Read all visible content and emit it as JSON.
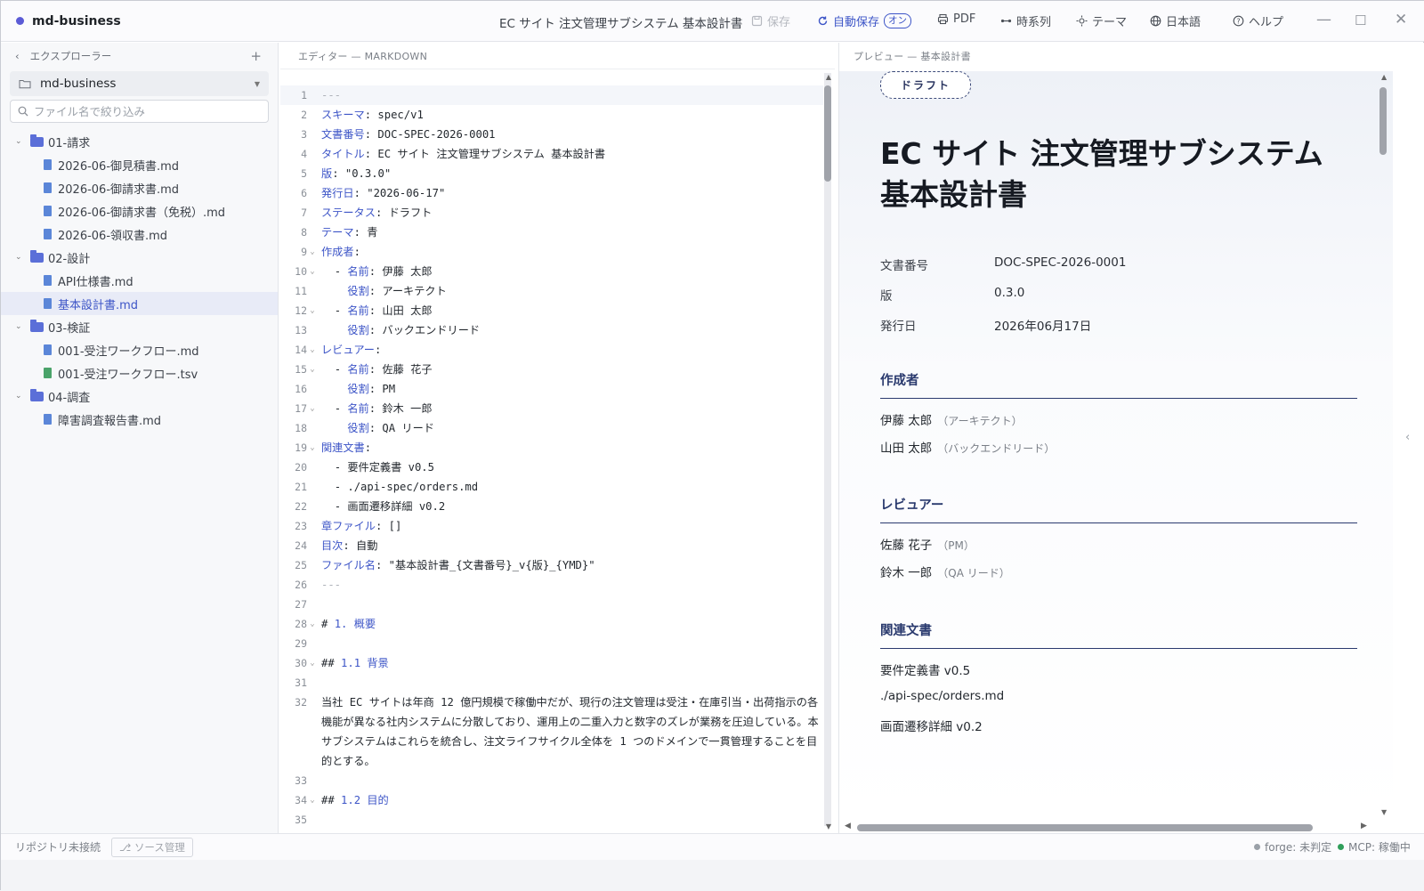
{
  "app": {
    "name": "md-business",
    "doc_title": "EC サイト 注文管理サブシステム 基本設計書",
    "accent": "#3d55c7"
  },
  "toolbar": {
    "save": "保存",
    "autosave": "自動保存",
    "autosave_state": "オン",
    "pdf": "PDF",
    "history": "時系列",
    "theme": "テーマ",
    "language": "日本語",
    "help": "ヘルプ"
  },
  "sidebar": {
    "title": "エクスプローラー",
    "repo": "md-business",
    "search_placeholder": "ファイル名で絞り込み",
    "tree": [
      {
        "type": "folder",
        "label": "01-請求"
      },
      {
        "type": "file",
        "label": "2026-06-御見積書.md"
      },
      {
        "type": "file",
        "label": "2026-06-御請求書.md"
      },
      {
        "type": "file",
        "label": "2026-06-御請求書（免税）.md"
      },
      {
        "type": "file",
        "label": "2026-06-領収書.md"
      },
      {
        "type": "folder",
        "label": "02-設計"
      },
      {
        "type": "file",
        "label": "API仕様書.md"
      },
      {
        "type": "file",
        "label": "基本設計書.md",
        "selected": true
      },
      {
        "type": "folder",
        "label": "03-検証"
      },
      {
        "type": "file",
        "label": "001-受注ワークフロー.md"
      },
      {
        "type": "tsv",
        "label": "001-受注ワークフロー.tsv"
      },
      {
        "type": "folder",
        "label": "04-調査"
      },
      {
        "type": "file",
        "label": "障害調査報告書.md"
      }
    ]
  },
  "editor": {
    "header": "エディター — MARKDOWN",
    "lines": [
      {
        "n": "1",
        "text": "---"
      },
      {
        "n": "2",
        "key": "スキーマ",
        "val": ": spec/v1"
      },
      {
        "n": "3",
        "key": "文書番号",
        "val": ": DOC-SPEC-2026-0001"
      },
      {
        "n": "4",
        "key": "タイトル",
        "val": ": EC サイト 注文管理サブシステム 基本設計書"
      },
      {
        "n": "5",
        "key": "版",
        "val": ": \"0.3.0\""
      },
      {
        "n": "6",
        "key": "発行日",
        "val": ": \"2026-06-17\""
      },
      {
        "n": "7",
        "key": "ステータス",
        "val": ": ドラフト"
      },
      {
        "n": "8",
        "key": "テーマ",
        "val": ": 青"
      },
      {
        "n": "9",
        "key": "作成者",
        "val": ":",
        "fold": true
      },
      {
        "n": "10",
        "pre": "  - ",
        "key": "名前",
        "val": ": 伊藤 太郎",
        "fold": true
      },
      {
        "n": "11",
        "pre": "    ",
        "key": "役割",
        "val": ": アーキテクト"
      },
      {
        "n": "12",
        "pre": "  - ",
        "key": "名前",
        "val": ": 山田 太郎",
        "fold": true
      },
      {
        "n": "13",
        "pre": "    ",
        "key": "役割",
        "val": ": バックエンドリード"
      },
      {
        "n": "14",
        "key": "レビュアー",
        "val": ":",
        "fold": true
      },
      {
        "n": "15",
        "pre": "  - ",
        "key": "名前",
        "val": ": 佐藤 花子",
        "fold": true
      },
      {
        "n": "16",
        "pre": "    ",
        "key": "役割",
        "val": ": PM"
      },
      {
        "n": "17",
        "pre": "  - ",
        "key": "名前",
        "val": ": 鈴木 一郎",
        "fold": true
      },
      {
        "n": "18",
        "pre": "    ",
        "key": "役割",
        "val": ": QA リード"
      },
      {
        "n": "19",
        "key": "関連文書",
        "val": ":",
        "fold": true
      },
      {
        "n": "20",
        "text": "  - 要件定義書 v0.5"
      },
      {
        "n": "21",
        "text": "  - ./api-spec/orders.md"
      },
      {
        "n": "22",
        "text": "  - 画面遷移詳細 v0.2"
      },
      {
        "n": "23",
        "key": "章ファイル",
        "val": ": []"
      },
      {
        "n": "24",
        "key": "目次",
        "val": ": 自動"
      },
      {
        "n": "25",
        "key": "ファイル名",
        "val": ": \"基本設計書_{文書番号}_v{版}_{YMD}\""
      },
      {
        "n": "26",
        "text": "---"
      },
      {
        "n": "27",
        "text": ""
      },
      {
        "n": "28",
        "mark": "# ",
        "heading": "1. 概要",
        "fold": true
      },
      {
        "n": "29",
        "text": ""
      },
      {
        "n": "30",
        "mark": "## ",
        "heading": "1.1 背景",
        "fold": true
      },
      {
        "n": "31",
        "text": ""
      },
      {
        "n": "32",
        "text": "当社 EC サイトは年商 12 億円規模で稼働中だが、現行の注文管理は受注・在庫引当・出荷指示の各機能が異なる社内システムに分散しており、運用上の二重入力と数字のズレが業務を圧迫している。本サブシステムはこれらを統合し、注文ライフサイクル全体を 1 つのドメインで一貫管理することを目的とする。"
      },
      {
        "n": "33",
        "text": ""
      },
      {
        "n": "34",
        "mark": "## ",
        "heading": "1.2 目的",
        "fold": true
      },
      {
        "n": "35",
        "text": ""
      }
    ]
  },
  "preview": {
    "header": "プレビュー — 基本設計書",
    "badge": "ドラフト",
    "title": "EC サイト 注文管理サブシステム 基本設計書",
    "meta": [
      {
        "k": "文書番号",
        "v": "DOC-SPEC-2026-0001"
      },
      {
        "k": "版",
        "v": "0.3.0"
      },
      {
        "k": "発行日",
        "v": "2026年06月17日"
      }
    ],
    "authors_title": "作成者",
    "authors": [
      {
        "name": "伊藤 太郎",
        "role": "（アーキテクト）"
      },
      {
        "name": "山田 太郎",
        "role": "（バックエンドリード）"
      }
    ],
    "reviewers_title": "レビュアー",
    "reviewers": [
      {
        "name": "佐藤 花子",
        "role": "（PM）"
      },
      {
        "name": "鈴木 一郎",
        "role": "（QA リード）"
      }
    ],
    "related_title": "関連文書",
    "related": [
      "要件定義書 v0.5",
      "./api-spec/orders.md",
      "画面遷移詳細 v0.2"
    ]
  },
  "status": {
    "repo": "リポジトリ未接続",
    "source_control": "ソース管理",
    "forge": "forge: 未判定",
    "forge_color": "#9aa0a8",
    "mcp": "MCP: 稼働中",
    "mcp_color": "#2f9e5a"
  }
}
